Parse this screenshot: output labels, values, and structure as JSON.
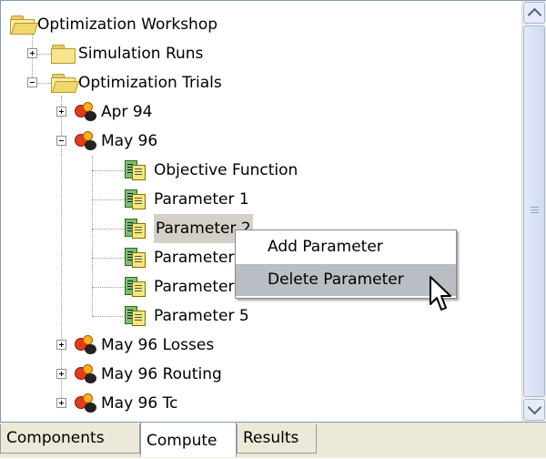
{
  "tree": {
    "root": {
      "label": "Optimization Workshop",
      "icon": "folder-open-icon"
    },
    "simulation_runs": {
      "label": "Simulation Runs",
      "icon": "folder-icon"
    },
    "optimization_trials": {
      "label": "Optimization Trials",
      "icon": "folder-open-icon"
    },
    "trials": [
      {
        "label": "Apr 94",
        "expanded": false
      },
      {
        "label": "May 96",
        "expanded": true
      },
      {
        "label": "May 96 Losses",
        "expanded": false
      },
      {
        "label": "May 96 Routing",
        "expanded": false
      },
      {
        "label": "May 96 Tc",
        "expanded": false
      }
    ],
    "may96_children": [
      {
        "label": "Objective Function"
      },
      {
        "label": "Parameter 1"
      },
      {
        "label": "Parameter 2",
        "selected": true
      },
      {
        "label": "Parameter 3"
      },
      {
        "label": "Parameter 4"
      },
      {
        "label": "Parameter 5"
      }
    ]
  },
  "context_menu": {
    "items": [
      {
        "label": "Add Parameter"
      },
      {
        "label": "Delete Parameter",
        "highlighted": true
      }
    ]
  },
  "tabs": [
    {
      "label": "Components",
      "active": false
    },
    {
      "label": "Compute",
      "active": true
    },
    {
      "label": "Results",
      "active": false
    }
  ],
  "colors": {
    "border": "#7f9db9",
    "selection": "#d4d0c8",
    "menu_highlight": "#b9bdc4",
    "tab_bar": "#ece9d8"
  }
}
